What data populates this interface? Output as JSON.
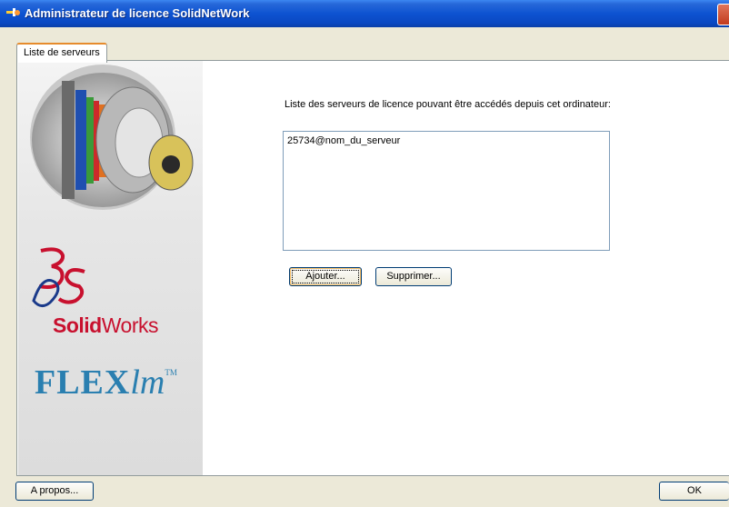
{
  "window": {
    "title": "Administrateur de licence SolidNetWork"
  },
  "tabs": [
    {
      "label": "Liste de serveurs",
      "active": true
    }
  ],
  "sidebar": {
    "logo_brand_bold": "Solid",
    "logo_brand_light": "Works",
    "flexlm_bold": "FLEX",
    "flexlm_italic": "lm",
    "flexlm_tm": "TM"
  },
  "main": {
    "servers_label": "Liste des serveurs de licence pouvant être accédés depuis cet ordinateur:",
    "servers": [
      "25734@nom_du_serveur"
    ],
    "add_button": "Ajouter...",
    "remove_button": "Supprimer..."
  },
  "footer": {
    "about_button": "A propos...",
    "ok_button": "OK"
  },
  "colors": {
    "titlebar": "#0a48c2",
    "tab_accent": "#e68b2c",
    "solidworks_red": "#c8102e",
    "flexlm_blue": "#2a7fb0"
  },
  "icons": [
    "app-icon",
    "close-icon",
    "solidworks-ds-logo-icon"
  ]
}
